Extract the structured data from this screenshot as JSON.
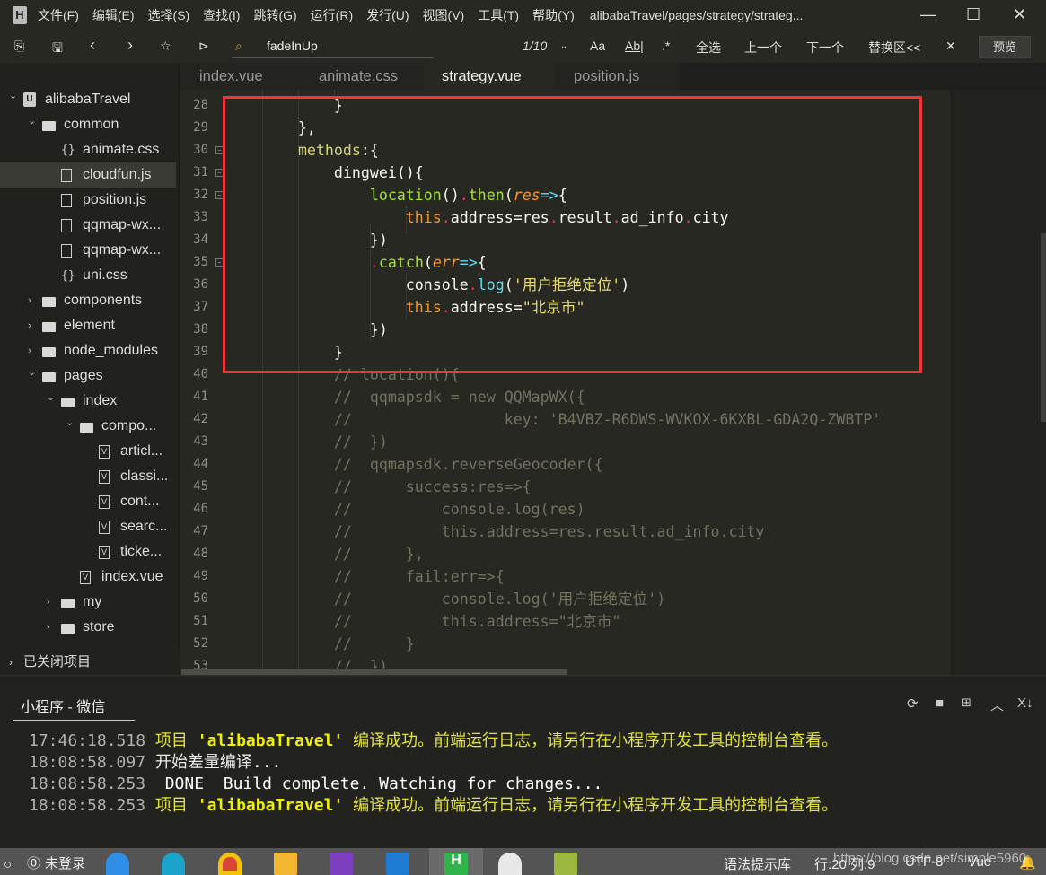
{
  "titlebar": {
    "menus": [
      "文件(F)",
      "编辑(E)",
      "选择(S)",
      "查找(I)",
      "跳转(G)",
      "运行(R)",
      "发行(U)",
      "视图(V)",
      "工具(T)",
      "帮助(Y)"
    ],
    "window_title": "alibabaTravel/pages/strategy/strateg...",
    "minimize": "—",
    "maximize": "☐",
    "close": "✕"
  },
  "toolbar": {
    "find_value": "fadeInUp",
    "match_count": "1/10",
    "case_label": "Aa",
    "word_label": "Ab|",
    "regex_label": ".*",
    "select_all": "全选",
    "prev": "上一个",
    "next": "下一个",
    "replace": "替换区<<",
    "close": "✕",
    "preview": "预览"
  },
  "tabs": [
    {
      "label": "index.vue",
      "active": false
    },
    {
      "label": "animate.css",
      "active": false
    },
    {
      "label": "strategy.vue",
      "active": true
    },
    {
      "label": "position.js",
      "active": false
    }
  ],
  "sidebar": {
    "items": [
      {
        "label": "alibabaTravel",
        "level": 0,
        "icon": "project",
        "expanded": true
      },
      {
        "label": "common",
        "level": 1,
        "icon": "folder",
        "expanded": true
      },
      {
        "label": "animate.css",
        "level": 2,
        "icon": "css"
      },
      {
        "label": "cloudfun.js",
        "level": 2,
        "icon": "file",
        "selected": true
      },
      {
        "label": "position.js",
        "level": 2,
        "icon": "file"
      },
      {
        "label": "qqmap-wx...",
        "level": 2,
        "icon": "file"
      },
      {
        "label": "qqmap-wx...",
        "level": 2,
        "icon": "file"
      },
      {
        "label": "uni.css",
        "level": 2,
        "icon": "css"
      },
      {
        "label": "components",
        "level": 1,
        "icon": "folder",
        "expanded": false
      },
      {
        "label": "element",
        "level": 1,
        "icon": "folder",
        "expanded": false
      },
      {
        "label": "node_modules",
        "level": 1,
        "icon": "folder",
        "expanded": false
      },
      {
        "label": "pages",
        "level": 1,
        "icon": "folder",
        "expanded": true
      },
      {
        "label": "index",
        "level": 2,
        "icon": "folder",
        "expanded": true
      },
      {
        "label": "compo...",
        "level": 3,
        "icon": "folder",
        "expanded": true
      },
      {
        "label": "articl...",
        "level": 4,
        "icon": "vue"
      },
      {
        "label": "classi...",
        "level": 4,
        "icon": "vue"
      },
      {
        "label": "cont...",
        "level": 4,
        "icon": "vue"
      },
      {
        "label": "searc...",
        "level": 4,
        "icon": "vue"
      },
      {
        "label": "ticke...",
        "level": 4,
        "icon": "vue"
      },
      {
        "label": "index.vue",
        "level": 3,
        "icon": "vue"
      },
      {
        "label": "my",
        "level": 2,
        "icon": "folder",
        "expanded": false
      },
      {
        "label": "store",
        "level": 2,
        "icon": "folder",
        "expanded": false
      }
    ],
    "closed_projects": "已关闭项目"
  },
  "editor": {
    "lines": [
      {
        "n": "28",
        "fold": false,
        "tokens": [
          [
            "            }",
            "p"
          ]
        ]
      },
      {
        "n": "29",
        "fold": false,
        "tokens": [
          [
            "        },",
            "p"
          ]
        ]
      },
      {
        "n": "30",
        "fold": true,
        "tokens": [
          [
            "        ",
            "p"
          ],
          [
            "methods",
            "k"
          ],
          [
            ":{",
            "p"
          ]
        ]
      },
      {
        "n": "31",
        "fold": true,
        "tokens": [
          [
            "            dingwei(){",
            "p"
          ]
        ]
      },
      {
        "n": "32",
        "fold": true,
        "tokens": [
          [
            "                ",
            "p"
          ],
          [
            "location",
            "f"
          ],
          [
            "()",
            "p"
          ],
          [
            ".",
            "d"
          ],
          [
            "then",
            "f"
          ],
          [
            "(",
            "p"
          ],
          [
            "res",
            "a"
          ],
          [
            "=>",
            "c"
          ],
          [
            "{",
            "p"
          ]
        ]
      },
      {
        "n": "33",
        "fold": false,
        "tokens": [
          [
            "                    ",
            "p"
          ],
          [
            "this",
            "t"
          ],
          [
            ".",
            "d"
          ],
          [
            "address=res",
            "p"
          ],
          [
            ".",
            "d"
          ],
          [
            "result",
            "p"
          ],
          [
            ".",
            "d"
          ],
          [
            "ad_info",
            "p"
          ],
          [
            ".",
            "d"
          ],
          [
            "city",
            "p"
          ]
        ]
      },
      {
        "n": "34",
        "fold": false,
        "tokens": [
          [
            "                })",
            "p"
          ]
        ]
      },
      {
        "n": "35",
        "fold": true,
        "tokens": [
          [
            "                ",
            "p"
          ],
          [
            ".",
            "d"
          ],
          [
            "catch",
            "f"
          ],
          [
            "(",
            "p"
          ],
          [
            "err",
            "a"
          ],
          [
            "=>",
            "c"
          ],
          [
            "{",
            "p"
          ]
        ]
      },
      {
        "n": "36",
        "fold": false,
        "tokens": [
          [
            "                    console",
            "p"
          ],
          [
            ".",
            "d"
          ],
          [
            "log",
            "c"
          ],
          [
            "(",
            "p"
          ],
          [
            "'用户拒绝定位'",
            "s"
          ],
          [
            ")",
            "p"
          ]
        ]
      },
      {
        "n": "37",
        "fold": false,
        "tokens": [
          [
            "                    ",
            "p"
          ],
          [
            "this",
            "t"
          ],
          [
            ".",
            "d"
          ],
          [
            "address=",
            "p"
          ],
          [
            "\"北京市\"",
            "s"
          ]
        ]
      },
      {
        "n": "38",
        "fold": false,
        "tokens": [
          [
            "                })",
            "p"
          ]
        ]
      },
      {
        "n": "39",
        "fold": false,
        "tokens": [
          [
            "            }",
            "p"
          ]
        ]
      },
      {
        "n": "40",
        "fold": false,
        "tokens": [
          [
            "            // location(){",
            "cm"
          ]
        ]
      },
      {
        "n": "41",
        "fold": false,
        "tokens": [
          [
            "            //  qqmapsdk = new QQMapWX({",
            "cm"
          ]
        ]
      },
      {
        "n": "42",
        "fold": false,
        "tokens": [
          [
            "            //                 key: 'B4VBZ-R6DWS-WVKOX-6KXBL-GDA2Q-ZWBTP'",
            "cm"
          ]
        ]
      },
      {
        "n": "43",
        "fold": false,
        "tokens": [
          [
            "            //  })",
            "cm"
          ]
        ]
      },
      {
        "n": "44",
        "fold": false,
        "tokens": [
          [
            "            //  qqmapsdk.reverseGeocoder({",
            "cm"
          ]
        ]
      },
      {
        "n": "45",
        "fold": false,
        "tokens": [
          [
            "            //      success:res=>{",
            "cm"
          ]
        ]
      },
      {
        "n": "46",
        "fold": false,
        "tokens": [
          [
            "            //          console.log(res)",
            "cm"
          ]
        ]
      },
      {
        "n": "47",
        "fold": false,
        "tokens": [
          [
            "            //          this.address=res.result.ad_info.city",
            "cm"
          ]
        ]
      },
      {
        "n": "48",
        "fold": false,
        "tokens": [
          [
            "            //      },",
            "cm"
          ]
        ]
      },
      {
        "n": "49",
        "fold": false,
        "tokens": [
          [
            "            //      fail:err=>{",
            "cm"
          ]
        ]
      },
      {
        "n": "50",
        "fold": false,
        "tokens": [
          [
            "            //          console.log('用户拒绝定位')",
            "cm"
          ]
        ]
      },
      {
        "n": "51",
        "fold": false,
        "tokens": [
          [
            "            //          this.address=\"北京市\"",
            "cm"
          ]
        ]
      },
      {
        "n": "52",
        "fold": false,
        "tokens": [
          [
            "            //      }",
            "cm"
          ]
        ]
      },
      {
        "n": "53",
        "fold": false,
        "tokens": [
          [
            "            //  })",
            "cm"
          ]
        ]
      }
    ]
  },
  "panel": {
    "tab_label": "小程序 - 微信",
    "logs": [
      {
        "time": "17:46:18.518",
        "parts": [
          [
            " 项目 ",
            "y"
          ],
          [
            "'alibabaTravel'",
            "yb"
          ],
          [
            " 编译成功。前端运行日志，请另行在小程序开发工具的控制台查看。",
            "y"
          ]
        ]
      },
      {
        "time": "18:08:58.097",
        "parts": [
          [
            " 开始差量编译...",
            "w"
          ]
        ]
      },
      {
        "time": "18:08:58.253",
        "parts": [
          [
            "  DONE  Build complete. Watching for changes...",
            "wb"
          ]
        ]
      },
      {
        "time": "18:08:58.253",
        "parts": [
          [
            " 项目 ",
            "y"
          ],
          [
            "'alibabaTravel'",
            "yb"
          ],
          [
            " 编译成功。前端运行日志，请另行在小程序开发工具的控制台查看。",
            "y"
          ]
        ]
      }
    ]
  },
  "statusbar": {
    "login": "未登录",
    "syntax": "语法提示库",
    "position": "行:20  列:9",
    "encoding": "UTF-8",
    "language": "Vue",
    "watermark": "https://blog.csdn.net/simple5960"
  },
  "colors": {
    "highlight_box": "#f0343a",
    "background": "#272822"
  }
}
